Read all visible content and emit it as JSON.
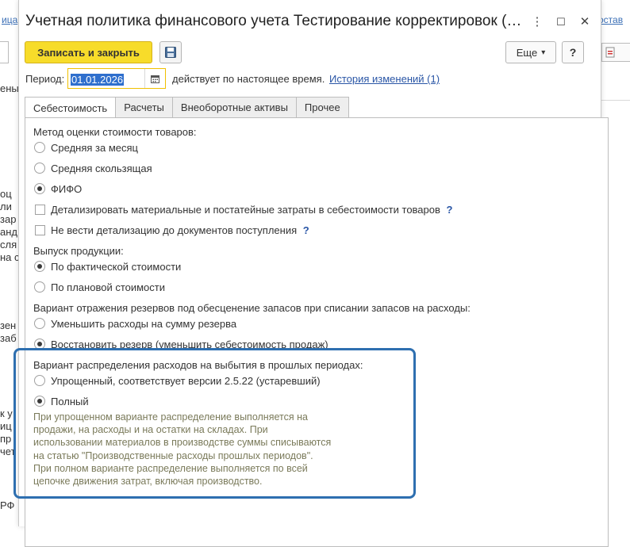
{
  "background": {
    "left_fragments": [
      "ица",
      "ены",
      "оц",
      "ли",
      "зар",
      "анд",
      "сля",
      "на с",
      "зен",
      "заб",
      "к у",
      "иц",
      "пр",
      "чет",
      "РФ"
    ],
    "right_link": "остав"
  },
  "dialog": {
    "title": "Учетная политика финансового учета Тестирование корректировок (…",
    "window_buttons": {
      "more": "⋮",
      "maximize": "☐",
      "close": "✕"
    },
    "toolbar": {
      "save_close_label": "Записать и закрыть",
      "save_icon": "floppy-disk-icon",
      "more_label": "Еще",
      "more_arrow": "▾",
      "help_label": "?"
    },
    "period": {
      "label": "Период:",
      "value": "01.01.2026",
      "calendar_icon": "calendar-icon",
      "acts_text": "действует по настоящее время.",
      "history_link": "История изменений (1)"
    },
    "tabs": [
      {
        "label": "Себестоимость",
        "active": true
      },
      {
        "label": "Расчеты",
        "active": false
      },
      {
        "label": "Внеоборотные активы",
        "active": false
      },
      {
        "label": "Прочее",
        "active": false
      }
    ],
    "cost": {
      "method_label": "Метод оценки стоимости товаров:",
      "method_options": [
        "Средняя за месяц",
        "Средняя скользящая",
        "ФИФО"
      ],
      "method_selected": "ФИФО",
      "checkbox_detail": "Детализировать материальные и постатейные затраты в себестоимости товаров",
      "checkbox_no_docs": "Не вести детализацию до документов поступления",
      "output_label": "Выпуск продукции:",
      "output_options": [
        "По фактической стоимости",
        "По плановой стоимости"
      ],
      "output_selected": "По фактической стоимости",
      "reserve_label": "Вариант отражения резервов под обесценение запасов при списании запасов на расходы:",
      "reserve_options": [
        "Уменьшить расходы на сумму резерва",
        "Восстановить резерв (уменьшить себестоимость продаж)"
      ],
      "reserve_selected": "Восстановить резерв (уменьшить себестоимость продаж)",
      "distribution_label": "Вариант распределения расходов на выбытия в прошлых периодах:",
      "distribution_options": [
        "Упрощенный, соответствует версии 2.5.22 (устаревший)",
        "Полный"
      ],
      "distribution_selected": "Полный",
      "hint": "При упрощенном варианте распределение выполняется на\nпродажи, на расходы и на остатки на складах. При\nиспользовании материалов в производстве суммы списываются\nна статью \"Производственные расходы прошлых периодов\".\nПри полном варианте распределение выполняется по всей\nцепочке движения затрат, включая производство."
    }
  },
  "colors": {
    "primary_button": "#f7dc2a",
    "highlight": "#2e6fb0",
    "link": "#2a56a6",
    "selection": "#2f6fcd"
  }
}
